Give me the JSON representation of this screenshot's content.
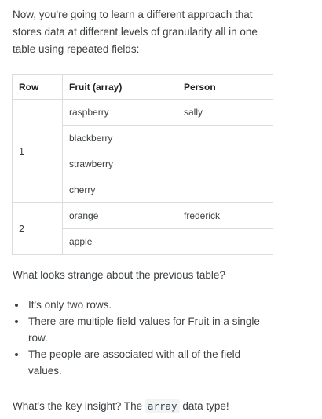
{
  "intro": "Now, you're going to learn a different approach that stores data at different levels of granularity all in one table using repeated fields:",
  "table": {
    "headers": [
      "Row",
      "Fruit (array)",
      "Person"
    ],
    "rows": [
      {
        "row": "1",
        "fruits": [
          "raspberry",
          "blackberry",
          "strawberry",
          "cherry"
        ],
        "person": "sally"
      },
      {
        "row": "2",
        "fruits": [
          "orange",
          "apple"
        ],
        "person": "frederick"
      }
    ]
  },
  "question": "What looks strange about the previous table?",
  "points": [
    "It's only two rows.",
    "There are multiple field values for Fruit in a single row.",
    "The people are associated with all of the field values."
  ],
  "insight": {
    "prefix": "What's the key insight? The ",
    "code": "array",
    "suffix": " data type!"
  }
}
